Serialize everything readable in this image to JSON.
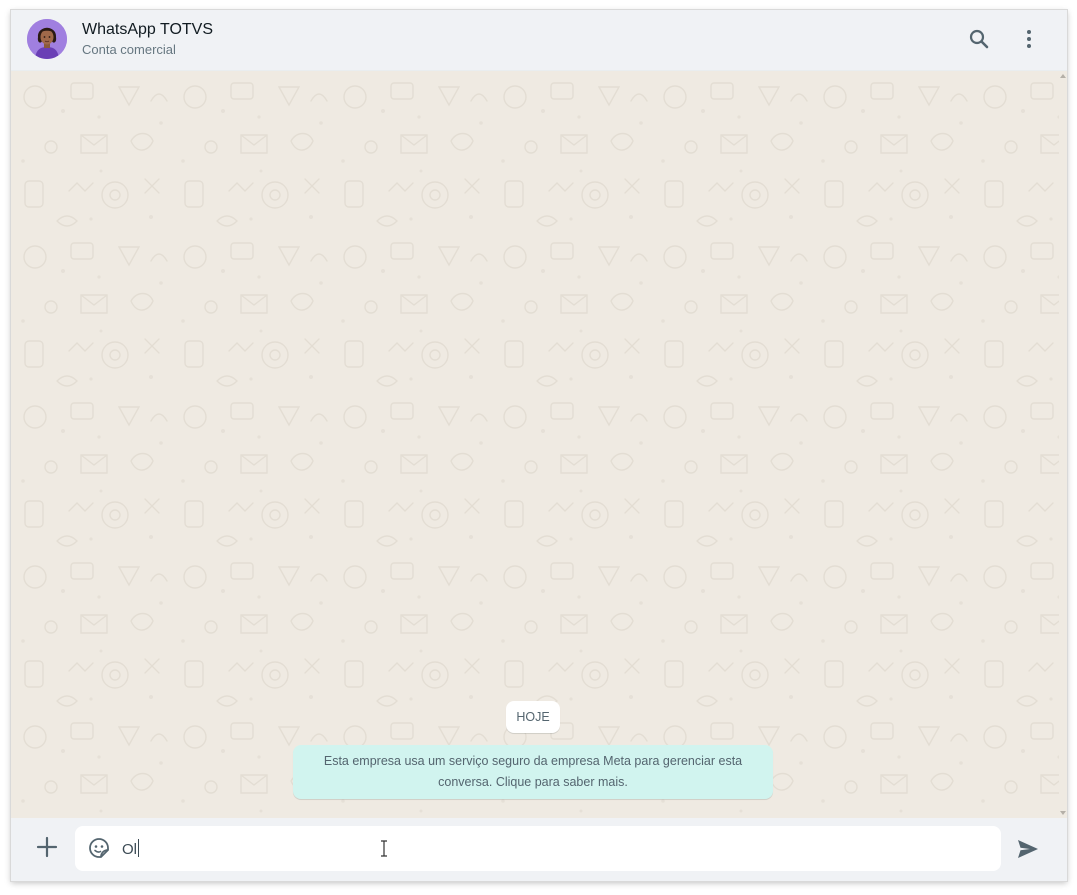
{
  "header": {
    "title": "WhatsApp TOTVS",
    "subtitle": "Conta comercial",
    "icons": [
      "search-icon",
      "menu-dots-icon"
    ]
  },
  "chat": {
    "date_chip": "HOJE",
    "system_message": "Esta empresa usa um serviço seguro da empresa Meta para gerenciar esta conversa. Clique para saber mais."
  },
  "composer": {
    "value": "Ol",
    "icons": [
      "plus-icon",
      "sticker-icon",
      "send-icon"
    ]
  },
  "colors": {
    "chat_background": "#efeae2",
    "header_background": "#f0f2f5",
    "system_bubble": "#d1f4ef",
    "icon": "#54656f"
  }
}
